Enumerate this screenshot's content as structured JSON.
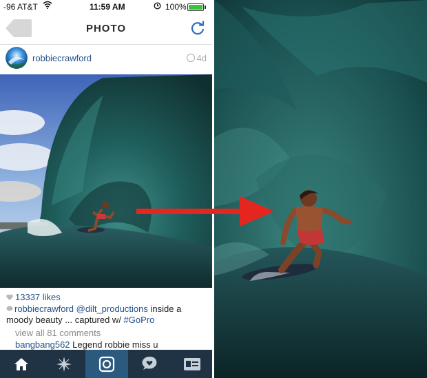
{
  "status": {
    "carrier": "-96 AT&T",
    "time": "11:59 AM",
    "battery": "100%",
    "battery_level": 1.0
  },
  "nav": {
    "title": "PHOTO",
    "back_icon": "back-arrow-icon",
    "refresh_icon": "refresh-icon"
  },
  "post": {
    "username": "robbiecrawford",
    "age": "4d",
    "likes": "13337 likes",
    "caption_user": "robbiecrawford",
    "caption_mention": "@dilt_productions",
    "caption_text": " inside a moody beauty ... captured w/ ",
    "caption_hashtag": "#GoPro",
    "view_all": "view all 81 comments",
    "comment_user": "bangbang562",
    "comment_text": " Legend robbie miss u"
  },
  "tabs": [
    "home-icon",
    "explore-icon",
    "camera-icon",
    "activity-icon",
    "profile-icon"
  ],
  "colors": {
    "link": "#24528a",
    "tabbar": "#1f3344",
    "tab_active": "#2c5a7f",
    "arrow": "#e5261f"
  }
}
